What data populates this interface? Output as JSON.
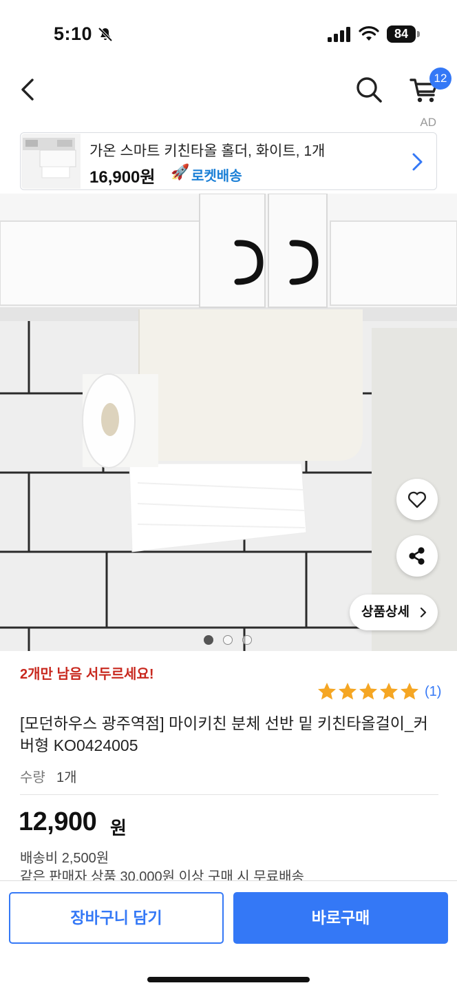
{
  "status_bar": {
    "time": "5:10",
    "battery": "84",
    "icons": [
      "bell-slash-icon",
      "signal-icon",
      "wifi-icon",
      "battery-icon"
    ]
  },
  "nav": {
    "cart_badge": "12",
    "ad_label": "AD",
    "icons": [
      "back-icon",
      "search-icon",
      "cart-icon"
    ]
  },
  "ad_banner": {
    "title": "가온 스마트 키친타올 홀더, 화이트, 1개",
    "price": "16,900원",
    "rocket_icon": "🚀",
    "rocket_label": "로켓배송"
  },
  "gallery": {
    "page_count": 3,
    "active_index": 0,
    "detail_button": "상품상세"
  },
  "product": {
    "urgency": "2개만 남음 서두르세요!",
    "rating": 5,
    "review_count": "(1)",
    "title": "[모던하우스 광주역점] 마이키친 분체 선반 밑 키친타올걸이_커버형 KO0424005",
    "qty_label": "수량",
    "qty_value": "1개",
    "price": "12,900",
    "price_unit": "원",
    "shipping": "배송비 2,500원",
    "free_shipping": "같은 판매자 상품 30,000원 이상 구매 시 무료배송"
  },
  "actions": {
    "add_to_cart": "장바구니 담기",
    "buy_now": "바로구매"
  },
  "colors": {
    "accent": "#3478f6",
    "urgency": "#c8281e",
    "rocket": "#1a7fd6",
    "star": "#f5a623"
  }
}
